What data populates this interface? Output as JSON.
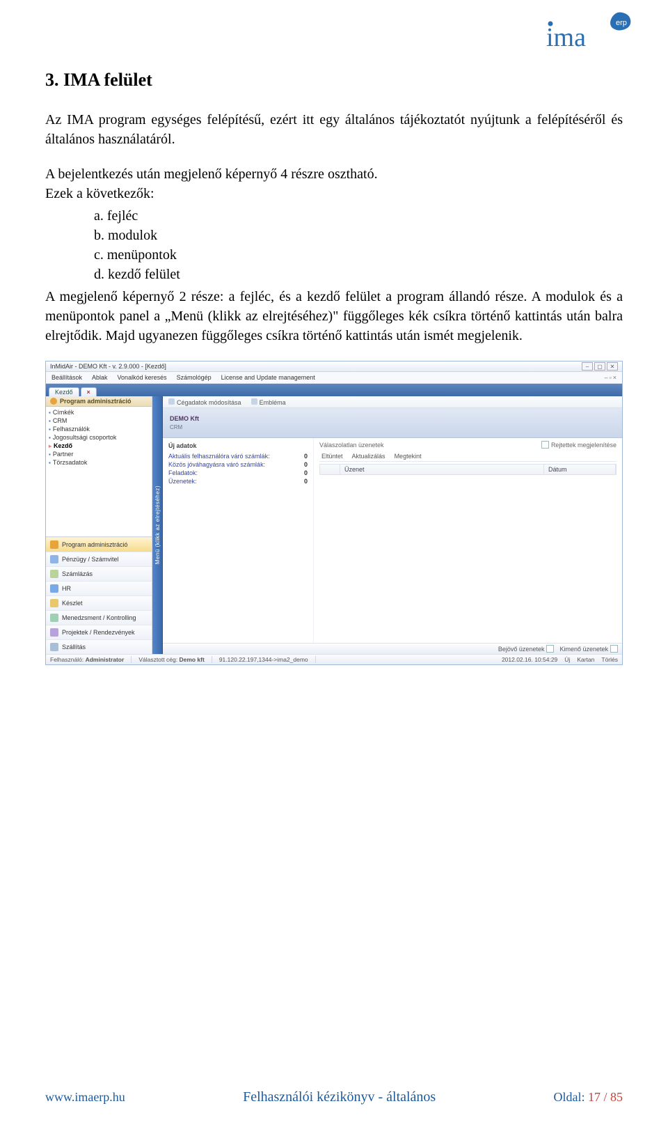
{
  "logo_text": "ima",
  "logo_badge": "erp",
  "heading": "3. IMA felület",
  "p1": "Az IMA program egységes felépítésű, ezért itt egy általános tájékoztatót nyújtunk a felépítéséről és általános használatáról.",
  "p2_lead": "A bejelentkezés után megjelenő képernyő 4 részre osztható.",
  "p2_intro": "Ezek a következők:",
  "list": {
    "a": "a.  fejléc",
    "b": "b.  modulok",
    "c": "c.  menüpontok",
    "d": "d.  kezdő felület"
  },
  "p3": "A megjelenő képernyő 2 része: a fejléc, és a kezdő felület a program állandó része. A modulok és a menüpontok panel a „Menü (klikk az elrejtéséhez)\" függőleges kék csíkra történő kattintás után balra elrejtődik. Majd ugyanezen függőleges csíkra történő kattintás után ismét megjelenik.",
  "ss": {
    "title": "InMidAir - DEMO Kft - v. 2.9.000 - [Kezdő]",
    "menubar": [
      "Beállítások",
      "Ablak",
      "Vonalkód keresés",
      "Számológép",
      "License and Update management"
    ],
    "tab_label": "Kezdő",
    "panel_title": "Program adminisztráció",
    "tree": [
      "Címkék",
      "CRM",
      "Felhasználók",
      "Jogosultsági csoportok",
      "Kezdő",
      "Partner",
      "Törzsadatok"
    ],
    "tree_selected": "Kezdő",
    "modules": [
      "Program adminisztráció",
      "Pénzügy / Számvitel",
      "Számlázás",
      "HR",
      "Készlet",
      "Menedzsment / Kontrolling",
      "Projektek / Rendezvények",
      "Szállítás"
    ],
    "vbar": "Menü (klikk az elrejtéséhez)",
    "toolbar": [
      "Cégadatok módosítása",
      "Embléma"
    ],
    "band_top": "DEMO Kft",
    "band_sub": "CRM",
    "left_sect": "Új adatok",
    "kv": [
      {
        "k": "Aktuális felhasználóra váró számlák:",
        "v": "0"
      },
      {
        "k": "Közös jóváhagyásra váró számlák:",
        "v": "0"
      },
      {
        "k": "Feladatok:",
        "v": "0"
      },
      {
        "k": "Üzenetek:",
        "v": "0"
      }
    ],
    "right_title": "Válaszolatlan üzenetek",
    "right_chk": "Rejtettek megjelenítése",
    "btnrow": [
      "Eltüntet",
      "Aktualizálás",
      "Megtekint"
    ],
    "grid_cols": [
      "",
      "Üzenet",
      "Dátum"
    ],
    "foot_left": "Bejövő üzenetek",
    "foot_right": "Kimenő üzenetek",
    "status": {
      "user_label": "Felhasználó:",
      "user": "Administrator",
      "company_label": "Választott cég:",
      "company": "Demo kft",
      "conn": "91.120.22.197,1344->ima2_demo",
      "datetime": "2012.02.16. 10:54:29",
      "right": [
        "Új",
        "Kartan",
        "Törlés"
      ]
    }
  },
  "footer": {
    "url": "www.imaerp.hu",
    "title": "Felhasználói kézikönyv - általános",
    "page_label": "Oldal: ",
    "page": "17 / 85"
  }
}
